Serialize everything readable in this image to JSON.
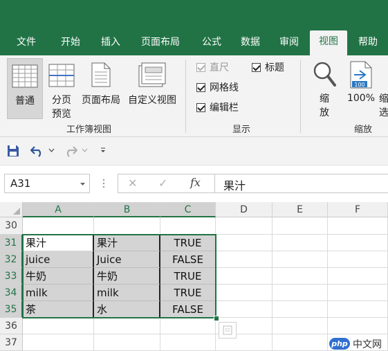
{
  "ribbon_tabs": [
    "文件",
    "开始",
    "插入",
    "页面布局",
    "公式",
    "数据",
    "审阅",
    "视图",
    "帮助"
  ],
  "active_tab": "视图",
  "workbook_views": {
    "group_label": "工作簿视图",
    "normal": "普通",
    "page_break_1": "分页",
    "page_break_2": "预览",
    "page_layout": "页面布局",
    "custom_views": "自定义视图"
  },
  "show": {
    "group_label": "显示",
    "ruler": "直尺",
    "headings": "标题",
    "gridlines": "网格线",
    "formula_bar": "编辑栏"
  },
  "zoom": {
    "group_label": "缩放",
    "zoom_1": "缩",
    "zoom_2": "放",
    "hundred": "100%",
    "selection_1": "缩",
    "selection_2": "选",
    "badge": "100"
  },
  "formula_bar": {
    "name_box": "A31",
    "cancel": "✕",
    "enter": "✓",
    "fx": "fx",
    "content": "果汁"
  },
  "columns": [
    "A",
    "B",
    "C",
    "D",
    "E",
    "F"
  ],
  "rows": [
    {
      "num": "30",
      "a": "",
      "b": "",
      "c": ""
    },
    {
      "num": "31",
      "a": "果汁",
      "b": "果汁",
      "c": "TRUE"
    },
    {
      "num": "32",
      "a": "juice",
      "b": "Juice",
      "c": "FALSE"
    },
    {
      "num": "33",
      "a": "牛奶",
      "b": "牛奶",
      "c": "TRUE"
    },
    {
      "num": "34",
      "a": "milk",
      "b": "milk",
      "c": "TRUE"
    },
    {
      "num": "35",
      "a": "茶",
      "b": "水",
      "c": "FALSE"
    },
    {
      "num": "36",
      "a": "",
      "b": "",
      "c": ""
    },
    {
      "num": "37",
      "a": "",
      "b": "",
      "c": ""
    }
  ],
  "watermark": "中文网",
  "watermark_logo": "php",
  "colors": {
    "excel_green": "#217346",
    "ribbon_bg": "#f3f3f3",
    "selection_gray": "#d4d4d4"
  }
}
